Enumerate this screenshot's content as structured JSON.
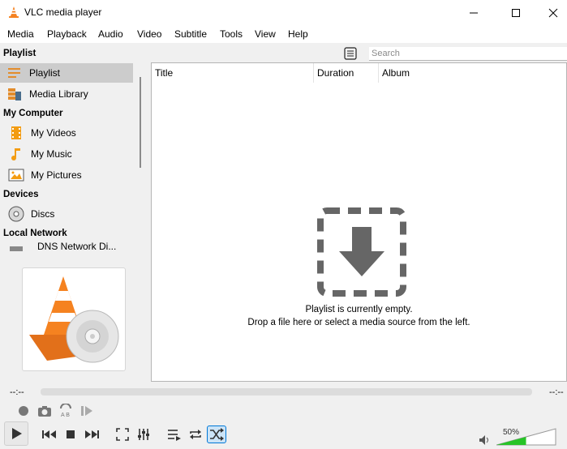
{
  "window": {
    "title": "VLC media player"
  },
  "menu": [
    "Media",
    "Playback",
    "Audio",
    "Video",
    "Subtitle",
    "Tools",
    "View",
    "Help"
  ],
  "sidebar": {
    "playlist_header": "Playlist",
    "playlist_items": [
      {
        "label": "Playlist",
        "icon": "playlist-icon",
        "selected": true
      },
      {
        "label": "Media Library",
        "icon": "media-library-icon"
      }
    ],
    "computer_header": "My Computer",
    "computer_items": [
      {
        "label": "My Videos",
        "icon": "film-icon"
      },
      {
        "label": "My Music",
        "icon": "music-note-icon"
      },
      {
        "label": "My Pictures",
        "icon": "picture-icon"
      }
    ],
    "devices_header": "Devices",
    "devices_items": [
      {
        "label": "Discs",
        "icon": "disc-icon"
      }
    ],
    "network_header": "Local Network",
    "network_items": [
      {
        "label": "DNS Network Di...",
        "icon": "network-icon"
      }
    ]
  },
  "search": {
    "placeholder": "Search"
  },
  "playlist": {
    "columns": [
      "Title",
      "Duration",
      "Album"
    ],
    "empty_line1": "Playlist is currently empty.",
    "empty_line2": "Drop a file here or select a media source from the left."
  },
  "seek": {
    "elapsed": "--:--",
    "remaining": "--:--"
  },
  "volume": {
    "percent_label": "50%",
    "level": 0.5
  },
  "colors": {
    "accent": "#0078d7",
    "volume_fill": "#27c427",
    "vlc_orange": "#f58220"
  }
}
